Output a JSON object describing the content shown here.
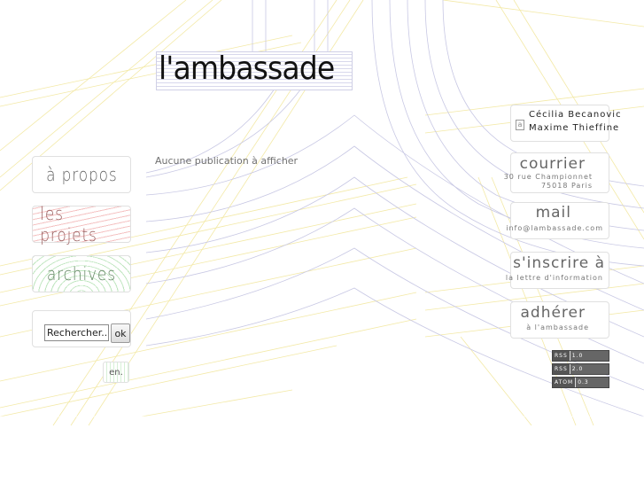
{
  "site": {
    "logo_text": "l'ambassade"
  },
  "nav": {
    "about": "à propos",
    "projects": "les projets",
    "archives": "archives"
  },
  "search": {
    "placeholder": "Rechercher...",
    "button": "ok"
  },
  "lang": "en.",
  "main": {
    "empty_message": "Aucune publication à afficher"
  },
  "contact": {
    "name1": "Cécilia Becanovic",
    "name2": "Maxime Thieffine",
    "courrier_title": "courrier",
    "courrier_line1": "30 rue Championnet",
    "courrier_line2": "75018 Paris",
    "mail_title": "mail",
    "mail_address": "info@lambassade.com",
    "subscribe_title": "s'inscrire à",
    "subscribe_sub": "la lettre d'information",
    "join_title": "adhérer",
    "join_sub": "à l'ambassade"
  },
  "feeds": [
    {
      "label": "RSS",
      "version": "1.0"
    },
    {
      "label": "RSS",
      "version": "2.0"
    },
    {
      "label": "ATOM",
      "version": "0.3"
    }
  ],
  "colors": {
    "line_yellow": "#f3e9a6",
    "line_lavender": "#c8c8e4",
    "text_gray": "#666666"
  }
}
